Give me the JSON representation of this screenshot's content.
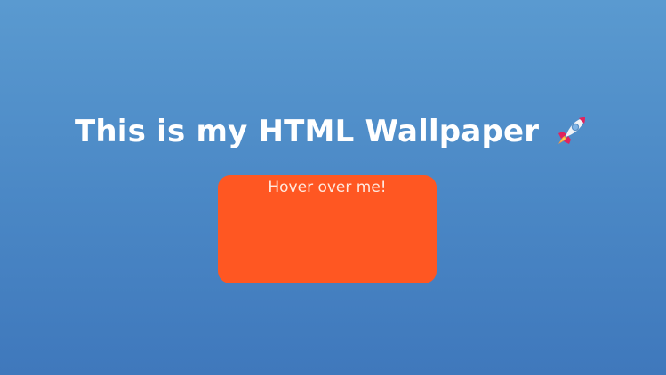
{
  "page": {
    "title": "This is my HTML Wallpaper",
    "title_icon": "rocket-icon"
  },
  "hover_box": {
    "label": "Hover over me!",
    "color": "#ff5722"
  },
  "colors": {
    "background_top": "#5a9ad0",
    "background_bottom": "#3f78bc",
    "title_text": "#ffffff"
  }
}
